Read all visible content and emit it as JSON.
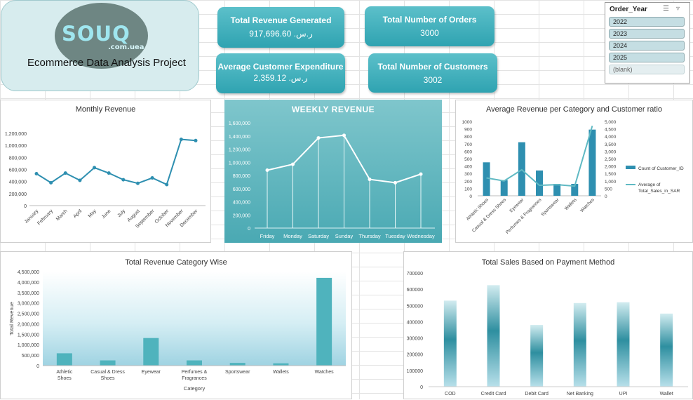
{
  "logo": {
    "brand": "SOUQ",
    "sub": ".com.uea"
  },
  "project_title": "Ecommerce Data Analysis Project",
  "kpis": [
    {
      "title": "Total Revenue Generated",
      "value": "917,696.60  .ر.س"
    },
    {
      "title": "Total Number of Orders",
      "value": "3000"
    },
    {
      "title": "Average Customer Expenditure",
      "value": "2,359.12  .ر.س"
    },
    {
      "title": "Total Number of Customers",
      "value": "3002"
    }
  ],
  "slicer": {
    "title": "Order_Year",
    "icons": [
      "multi-select-icon",
      "clear-filter-icon"
    ],
    "items": [
      "2022",
      "2023",
      "2024",
      "2025",
      "(blank)"
    ]
  },
  "charts": [
    {
      "chart_data": {
        "type": "line",
        "title": "Monthly Revenue",
        "categories": [
          "January",
          "February",
          "March",
          "April",
          "May",
          "June",
          "July",
          "August",
          "September",
          "October",
          "November",
          "December"
        ],
        "values": [
          530000,
          380000,
          540000,
          420000,
          630000,
          540000,
          430000,
          370000,
          460000,
          350000,
          1100000,
          1080000
        ],
        "yticks": [
          "0",
          "200,000",
          "400,000",
          "600,000",
          "800,000",
          "1,000,000",
          "1,200,000"
        ],
        "ylim": [
          0,
          1200000
        ],
        "color": "#2e8fb0"
      }
    },
    {
      "chart_data": {
        "type": "line",
        "title": "WEEKLY REVENUE",
        "categories": [
          "Friday",
          "Monday",
          "Saturday",
          "Sunday",
          "Thursday",
          "Tuesday",
          "Wednesday"
        ],
        "values": [
          880000,
          970000,
          1370000,
          1410000,
          740000,
          690000,
          820000
        ],
        "yticks": [
          "0",
          "200,000",
          "400,000",
          "600,000",
          "800,000",
          "1,000,000",
          "1,200,000",
          "1,400,000",
          "1,600,000"
        ],
        "ylim": [
          0,
          1600000
        ],
        "color": "#ffffff"
      }
    },
    {
      "chart_data": {
        "type": "bar",
        "title": "Average Revenue per Category and Customer ratio",
        "categories": [
          "Athletic Shoes",
          "Casual & Dress Shoes",
          "Eyewear",
          "Perfumes & Fragrances",
          "Sportswear",
          "Wallets",
          "Watches"
        ],
        "series": [
          {
            "name": "Count of Customer_ID",
            "values": [
              450,
              210,
              720,
              340,
              160,
              160,
              890
            ],
            "axis": "left",
            "color": "#2e8fb0"
          },
          {
            "name": "Average of Total_Sales_in_SAR",
            "values": [
              1200,
              1000,
              1750,
              700,
              750,
              650,
              4700
            ],
            "axis": "right",
            "color": "#5fb9c3"
          }
        ],
        "yticks_left": [
          "0",
          "100",
          "200",
          "300",
          "400",
          "500",
          "600",
          "700",
          "800",
          "900",
          "1000"
        ],
        "yticks_right": [
          "0",
          "500",
          "1,000",
          "1,500",
          "2,000",
          "2,500",
          "3,000",
          "3,500",
          "4,000",
          "4,500",
          "5,000"
        ],
        "ylim_left": [
          0,
          1000
        ],
        "ylim_right": [
          0,
          5000
        ]
      }
    },
    {
      "chart_data": {
        "type": "bar",
        "title": "Total Revenue Category Wise",
        "xlabel": "Category",
        "ylabel": "Total Revenue",
        "categories": [
          "Athletic Shoes",
          "Casual & Dress Shoes",
          "Eyewear",
          "Perfumes & Fragrances",
          "Sportswear",
          "Wallets",
          "Watches"
        ],
        "values": [
          590000,
          250000,
          1320000,
          250000,
          130000,
          110000,
          4200000
        ],
        "yticks": [
          "0",
          "500,000",
          "1,000,000",
          "1,500,000",
          "2,000,000",
          "2,500,000",
          "3,000,000",
          "3,500,000",
          "4,000,000",
          "4,500,000"
        ],
        "ylim": [
          0,
          4500000
        ],
        "color": "#4fb3bd"
      }
    },
    {
      "chart_data": {
        "type": "bar",
        "title": "Total Sales Based on Payment Method",
        "categories": [
          "COD",
          "Credit Card",
          "Debit Card",
          "Net Banking",
          "UPI",
          "Wallet"
        ],
        "values": [
          530000,
          625000,
          380000,
          515000,
          520000,
          450000
        ],
        "yticks": [
          "0",
          "100000",
          "200000",
          "300000",
          "400000",
          "500000",
          "600000",
          "700000"
        ],
        "ylim": [
          0,
          700000
        ],
        "color": "#2e8fa0"
      }
    }
  ]
}
